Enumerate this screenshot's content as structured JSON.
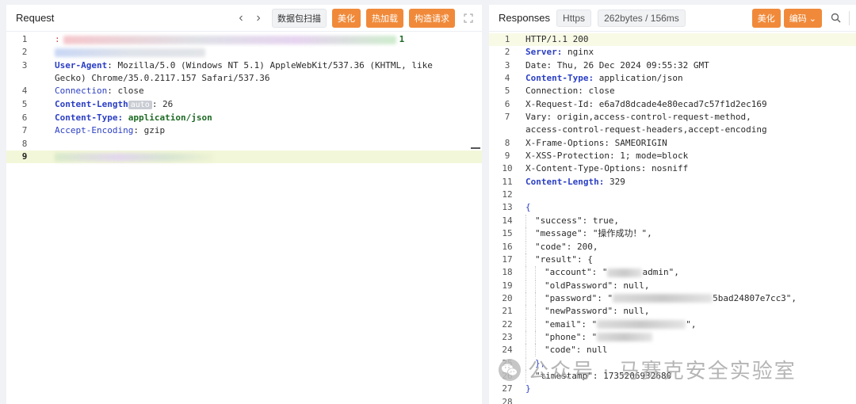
{
  "request": {
    "title": "Request",
    "buttons": {
      "scan": "数据包扫描",
      "beautify": "美化",
      "hot_load": "热加载",
      "construct": "构造请求"
    },
    "lines": [
      {
        "n": "1",
        "prefix": ":",
        "suffix": "1"
      },
      {
        "n": "2"
      },
      {
        "n": "3",
        "key": "User-Agent",
        "value": ": Mozilla/5.0 (Windows NT 5.1) AppleWebKit/537.36 (KHTML, like Gecko) Chrome/35.0.2117.157 Safari/537.36"
      },
      {
        "n": "4",
        "key": "Connection",
        "value": ": close"
      },
      {
        "n": "5",
        "key": "Content-Length",
        "badge": "auto",
        "value": ": 26"
      },
      {
        "n": "6",
        "key": "Content-Type",
        "value": "application/json"
      },
      {
        "n": "7",
        "key": "Accept-Encoding",
        "value": ": gzip"
      },
      {
        "n": "8"
      },
      {
        "n": "9"
      }
    ]
  },
  "response": {
    "title": "Responses",
    "tag_protocol": "Https",
    "tag_size": "262bytes / 156ms",
    "buttons": {
      "beautify": "美化",
      "encoding": "编码"
    },
    "lines": [
      {
        "n": "1",
        "text": "HTTP/1.1 200"
      },
      {
        "n": "2",
        "key": "Server:",
        "value": " nginx"
      },
      {
        "n": "3",
        "text": "Date: Thu, 26 Dec 2024 09:55:32 GMT"
      },
      {
        "n": "4",
        "key": "Content-Type:",
        "value": " application/json"
      },
      {
        "n": "5",
        "text": "Connection: close"
      },
      {
        "n": "6",
        "text": "X-Request-Id: e6a7d8dcade4e80ecad7c57f1d2ec169"
      },
      {
        "n": "7",
        "text": "Vary: origin,access-control-request-method,"
      },
      {
        "n": "",
        "text": "access-control-request-headers,accept-encoding"
      },
      {
        "n": "8",
        "text": "X-Frame-Options: SAMEORIGIN"
      },
      {
        "n": "9",
        "text": "X-XSS-Protection: 1; mode=block"
      },
      {
        "n": "10",
        "text": "X-Content-Type-Options: nosniff"
      },
      {
        "n": "11",
        "key": "Content-Length:",
        "value": " 329"
      },
      {
        "n": "12",
        "text": ""
      },
      {
        "n": "13",
        "text": "{"
      },
      {
        "n": "14",
        "text": "\"success\": true,"
      },
      {
        "n": "15",
        "text": "\"message\": \"操作成功！\","
      },
      {
        "n": "16",
        "text": "\"code\": 200,"
      },
      {
        "n": "17",
        "text": "\"result\": {"
      },
      {
        "n": "18",
        "pre": "\"account\": \"",
        "post": "admin\","
      },
      {
        "n": "19",
        "text": "\"oldPassword\": null,"
      },
      {
        "n": "20",
        "pre": "\"password\": \"",
        "post": "5bad24807e7cc3\","
      },
      {
        "n": "21",
        "text": "\"newPassword\": null,"
      },
      {
        "n": "22",
        "pre": "\"email\": \"",
        "post": "\","
      },
      {
        "n": "23",
        "pre": "\"phone\": \"",
        "post": ""
      },
      {
        "n": "24",
        "text": "\"code\": null"
      },
      {
        "n": "25",
        "text": "},"
      },
      {
        "n": "26",
        "text": "\"timestamp\": 1735206932680"
      },
      {
        "n": "27",
        "text": "}"
      },
      {
        "n": "28",
        "text": ""
      }
    ]
  },
  "watermark": "公众号 · 马赛克安全实验室",
  "colors": {
    "accent": "#f08a3a",
    "key": "#2b3fc4",
    "string_strong": "#1d6a24"
  }
}
